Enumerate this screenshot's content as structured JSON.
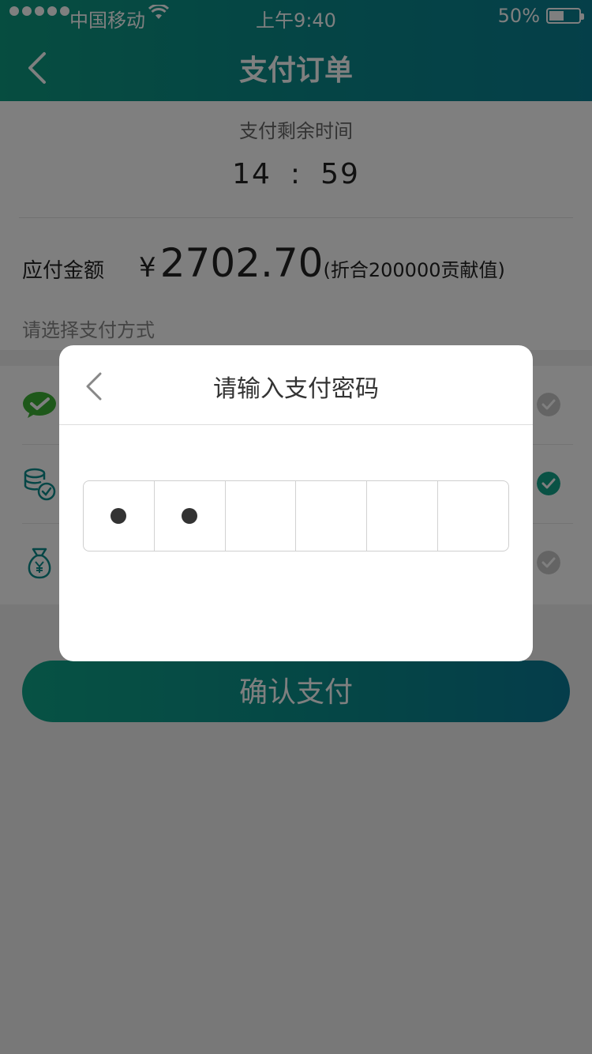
{
  "status_bar": {
    "carrier": "中国移动",
    "time": "上午9:40",
    "battery_percent": "50%",
    "battery_level": 0.5
  },
  "nav": {
    "title": "支付订单",
    "back_icon": "chevron-left-icon"
  },
  "countdown": {
    "label": "支付剩余时间",
    "minutes": "14",
    "separator": ":",
    "seconds": "59"
  },
  "amount": {
    "label": "应付金额",
    "currency": "¥",
    "value": "2702.70",
    "note": "(折合200000贡献值)"
  },
  "payment_methods": {
    "label": "请选择支付方式",
    "items": [
      {
        "icon": "wechat-icon",
        "selected": false
      },
      {
        "icon": "coins-check-icon",
        "selected": true
      },
      {
        "icon": "money-bag-icon",
        "selected": false
      }
    ]
  },
  "confirm_button": {
    "label": "确认支付"
  },
  "password_dialog": {
    "title": "请输入支付密码",
    "back_icon": "chevron-left-icon",
    "digits_total": 6,
    "digits_entered": 2
  },
  "colors": {
    "brand_teal": "#0a8c8c",
    "wechat_green": "#3cb034",
    "checked": "#12a58a",
    "unchecked": "#c8c8c8"
  }
}
